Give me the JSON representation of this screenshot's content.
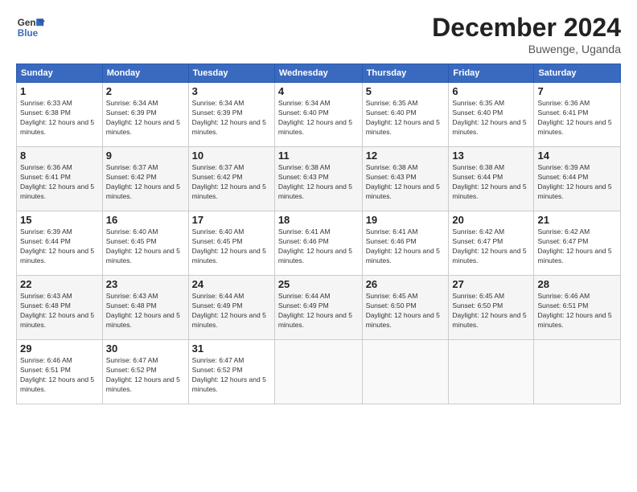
{
  "header": {
    "logo_line1": "General",
    "logo_line2": "Blue",
    "month": "December 2024",
    "location": "Buwenge, Uganda"
  },
  "days_of_week": [
    "Sunday",
    "Monday",
    "Tuesday",
    "Wednesday",
    "Thursday",
    "Friday",
    "Saturday"
  ],
  "weeks": [
    [
      {
        "day": 1,
        "sunrise": "6:33 AM",
        "sunset": "6:38 PM",
        "daylight": "12 hours and 5 minutes."
      },
      {
        "day": 2,
        "sunrise": "6:34 AM",
        "sunset": "6:39 PM",
        "daylight": "12 hours and 5 minutes."
      },
      {
        "day": 3,
        "sunrise": "6:34 AM",
        "sunset": "6:39 PM",
        "daylight": "12 hours and 5 minutes."
      },
      {
        "day": 4,
        "sunrise": "6:34 AM",
        "sunset": "6:40 PM",
        "daylight": "12 hours and 5 minutes."
      },
      {
        "day": 5,
        "sunrise": "6:35 AM",
        "sunset": "6:40 PM",
        "daylight": "12 hours and 5 minutes."
      },
      {
        "day": 6,
        "sunrise": "6:35 AM",
        "sunset": "6:40 PM",
        "daylight": "12 hours and 5 minutes."
      },
      {
        "day": 7,
        "sunrise": "6:36 AM",
        "sunset": "6:41 PM",
        "daylight": "12 hours and 5 minutes."
      }
    ],
    [
      {
        "day": 8,
        "sunrise": "6:36 AM",
        "sunset": "6:41 PM",
        "daylight": "12 hours and 5 minutes."
      },
      {
        "day": 9,
        "sunrise": "6:37 AM",
        "sunset": "6:42 PM",
        "daylight": "12 hours and 5 minutes."
      },
      {
        "day": 10,
        "sunrise": "6:37 AM",
        "sunset": "6:42 PM",
        "daylight": "12 hours and 5 minutes."
      },
      {
        "day": 11,
        "sunrise": "6:38 AM",
        "sunset": "6:43 PM",
        "daylight": "12 hours and 5 minutes."
      },
      {
        "day": 12,
        "sunrise": "6:38 AM",
        "sunset": "6:43 PM",
        "daylight": "12 hours and 5 minutes."
      },
      {
        "day": 13,
        "sunrise": "6:38 AM",
        "sunset": "6:44 PM",
        "daylight": "12 hours and 5 minutes."
      },
      {
        "day": 14,
        "sunrise": "6:39 AM",
        "sunset": "6:44 PM",
        "daylight": "12 hours and 5 minutes."
      }
    ],
    [
      {
        "day": 15,
        "sunrise": "6:39 AM",
        "sunset": "6:44 PM",
        "daylight": "12 hours and 5 minutes."
      },
      {
        "day": 16,
        "sunrise": "6:40 AM",
        "sunset": "6:45 PM",
        "daylight": "12 hours and 5 minutes."
      },
      {
        "day": 17,
        "sunrise": "6:40 AM",
        "sunset": "6:45 PM",
        "daylight": "12 hours and 5 minutes."
      },
      {
        "day": 18,
        "sunrise": "6:41 AM",
        "sunset": "6:46 PM",
        "daylight": "12 hours and 5 minutes."
      },
      {
        "day": 19,
        "sunrise": "6:41 AM",
        "sunset": "6:46 PM",
        "daylight": "12 hours and 5 minutes."
      },
      {
        "day": 20,
        "sunrise": "6:42 AM",
        "sunset": "6:47 PM",
        "daylight": "12 hours and 5 minutes."
      },
      {
        "day": 21,
        "sunrise": "6:42 AM",
        "sunset": "6:47 PM",
        "daylight": "12 hours and 5 minutes."
      }
    ],
    [
      {
        "day": 22,
        "sunrise": "6:43 AM",
        "sunset": "6:48 PM",
        "daylight": "12 hours and 5 minutes."
      },
      {
        "day": 23,
        "sunrise": "6:43 AM",
        "sunset": "6:48 PM",
        "daylight": "12 hours and 5 minutes."
      },
      {
        "day": 24,
        "sunrise": "6:44 AM",
        "sunset": "6:49 PM",
        "daylight": "12 hours and 5 minutes."
      },
      {
        "day": 25,
        "sunrise": "6:44 AM",
        "sunset": "6:49 PM",
        "daylight": "12 hours and 5 minutes."
      },
      {
        "day": 26,
        "sunrise": "6:45 AM",
        "sunset": "6:50 PM",
        "daylight": "12 hours and 5 minutes."
      },
      {
        "day": 27,
        "sunrise": "6:45 AM",
        "sunset": "6:50 PM",
        "daylight": "12 hours and 5 minutes."
      },
      {
        "day": 28,
        "sunrise": "6:46 AM",
        "sunset": "6:51 PM",
        "daylight": "12 hours and 5 minutes."
      }
    ],
    [
      {
        "day": 29,
        "sunrise": "6:46 AM",
        "sunset": "6:51 PM",
        "daylight": "12 hours and 5 minutes."
      },
      {
        "day": 30,
        "sunrise": "6:47 AM",
        "sunset": "6:52 PM",
        "daylight": "12 hours and 5 minutes."
      },
      {
        "day": 31,
        "sunrise": "6:47 AM",
        "sunset": "6:52 PM",
        "daylight": "12 hours and 5 minutes."
      },
      null,
      null,
      null,
      null
    ]
  ]
}
